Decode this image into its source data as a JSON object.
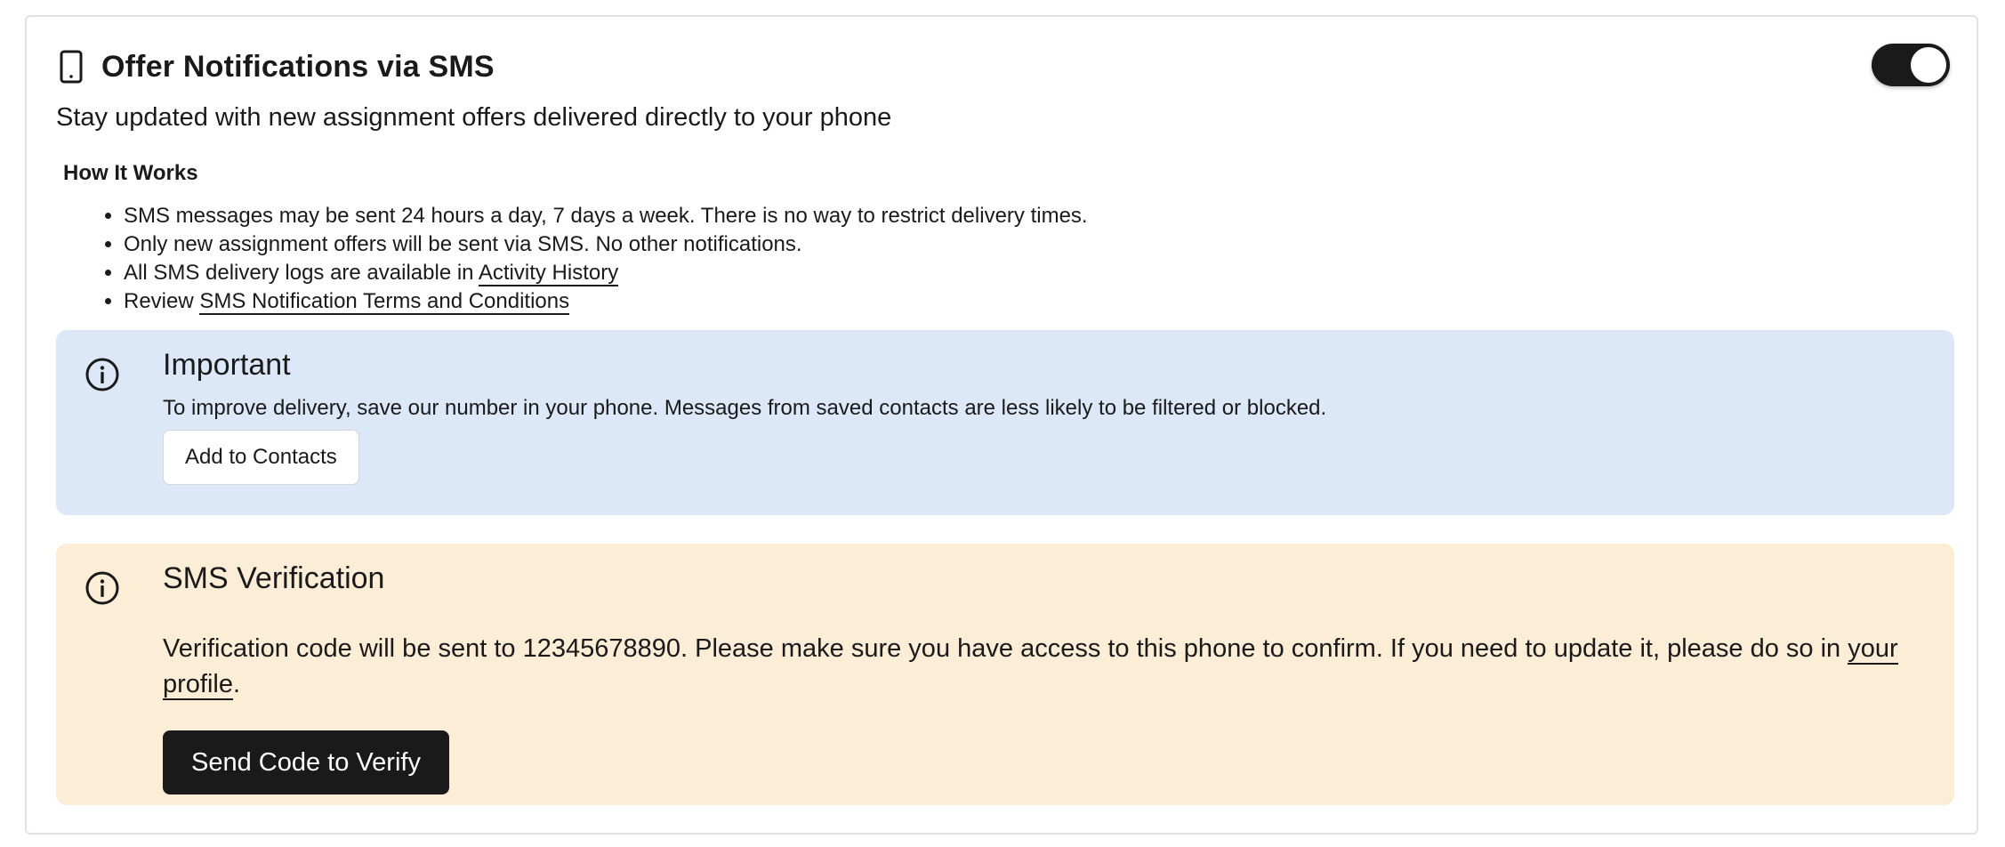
{
  "header": {
    "icon": "phone-icon",
    "title": "Offer Notifications via SMS",
    "toggle_on": true
  },
  "subtitle": "Stay updated with new assignment offers delivered directly to your phone",
  "how_it_works": {
    "title": "How It Works",
    "item1": "SMS messages may be sent 24 hours a day, 7 days a week. There is no way to restrict delivery times.",
    "item2": "Only new assignment offers will be sent via SMS. No other notifications.",
    "item3_prefix": "All SMS delivery logs are available in ",
    "item3_link": "Activity History",
    "item4_prefix": "Review ",
    "item4_link": "SMS Notification Terms and Conditions"
  },
  "important": {
    "icon": "info-icon",
    "title": "Important",
    "text": "To improve delivery, save our number in your phone. Messages from saved contacts are less likely to be filtered or blocked.",
    "button_label": "Add to Contacts",
    "background": "#dce7f8"
  },
  "verification": {
    "icon": "info-icon",
    "title": "SMS Verification",
    "text_prefix": "Verification code will be sent to 12345678890. Please make sure you have access to this phone to confirm. If you need to update it, please do so in ",
    "text_link": "your profile",
    "text_suffix": ".",
    "button_label": "Send Code to Verify",
    "background": "#fcedd7"
  },
  "colors": {
    "primary_dark": "#1a1a1a",
    "card_border": "#e2e2e2"
  }
}
